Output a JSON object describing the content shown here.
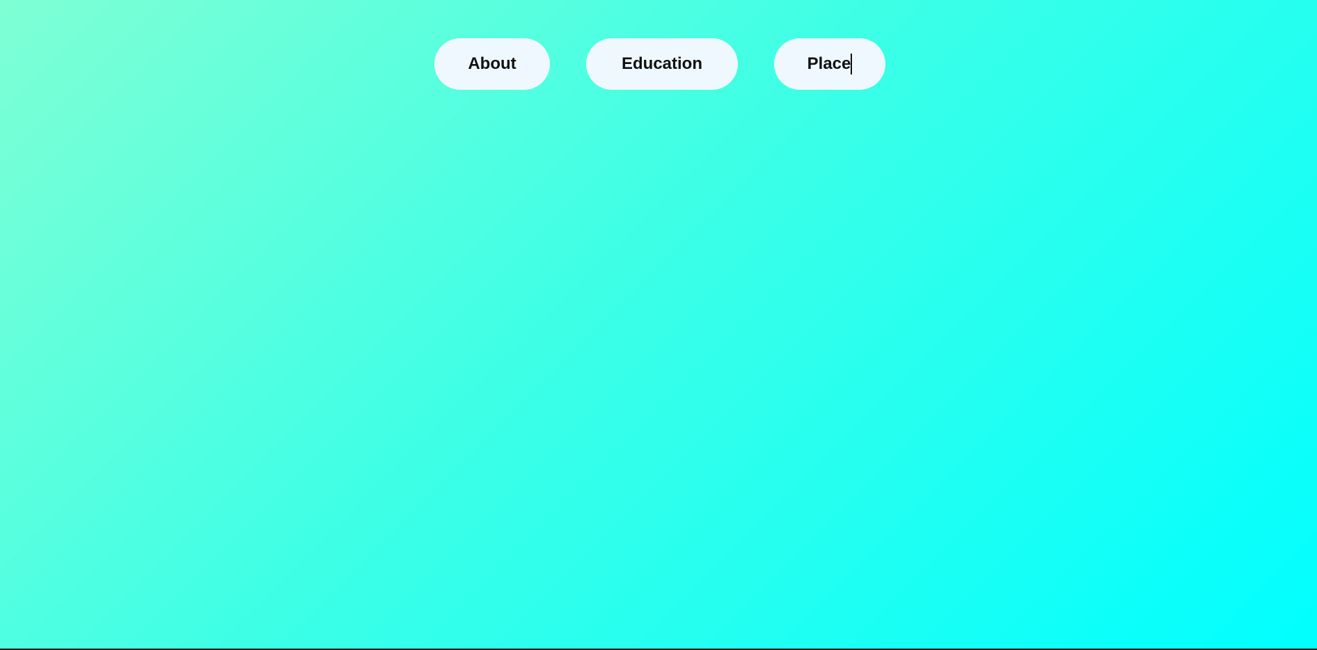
{
  "nav": {
    "items": [
      {
        "label": "About"
      },
      {
        "label": "Education"
      },
      {
        "label": "Place"
      }
    ]
  },
  "colors": {
    "background_start": "#7fffd4",
    "background_end": "#00ffff",
    "button_background": "#f0f8ff",
    "text": "#111111"
  }
}
